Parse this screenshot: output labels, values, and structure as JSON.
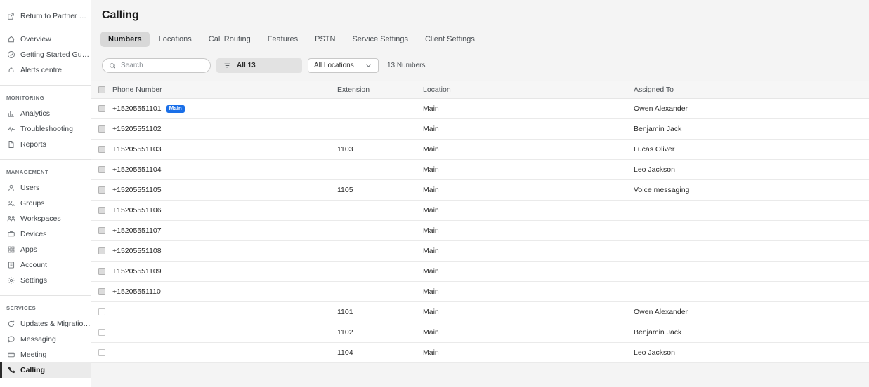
{
  "sidebar": {
    "top_link": {
      "label": "Return to Partner Hub",
      "icon": "external-link-icon"
    },
    "primary": [
      {
        "label": "Overview",
        "icon": "home-icon"
      },
      {
        "label": "Getting Started Guide",
        "icon": "check-circle-icon"
      },
      {
        "label": "Alerts centre",
        "icon": "bell-icon"
      }
    ],
    "sections": [
      {
        "title": "MONITORING",
        "items": [
          {
            "label": "Analytics",
            "icon": "bar-chart-icon"
          },
          {
            "label": "Troubleshooting",
            "icon": "pulse-icon"
          },
          {
            "label": "Reports",
            "icon": "document-icon"
          }
        ]
      },
      {
        "title": "MANAGEMENT",
        "items": [
          {
            "label": "Users",
            "icon": "user-icon"
          },
          {
            "label": "Groups",
            "icon": "user-group-icon"
          },
          {
            "label": "Workspaces",
            "icon": "workspaces-icon"
          },
          {
            "label": "Devices",
            "icon": "device-icon"
          },
          {
            "label": "Apps",
            "icon": "apps-grid-icon"
          },
          {
            "label": "Account",
            "icon": "account-icon"
          },
          {
            "label": "Settings",
            "icon": "gear-icon"
          }
        ]
      },
      {
        "title": "SERVICES",
        "items": [
          {
            "label": "Updates & Migrations",
            "icon": "refresh-icon"
          },
          {
            "label": "Messaging",
            "icon": "chat-bubble-icon"
          },
          {
            "label": "Meeting",
            "icon": "video-icon"
          },
          {
            "label": "Calling",
            "icon": "phone-handset-icon",
            "active": true
          }
        ]
      }
    ]
  },
  "header": {
    "title": "Calling"
  },
  "tabs": [
    {
      "label": "Numbers",
      "active": true
    },
    {
      "label": "Locations",
      "active": false
    },
    {
      "label": "Call Routing",
      "active": false
    },
    {
      "label": "Features",
      "active": false
    },
    {
      "label": "PSTN",
      "active": false
    },
    {
      "label": "Service Settings",
      "active": false
    },
    {
      "label": "Client Settings",
      "active": false
    }
  ],
  "toolbar": {
    "search": {
      "placeholder": "Search",
      "value": "",
      "icon": "search-icon"
    },
    "filter_button": {
      "label": "All 13",
      "icon": "filter-lines-icon"
    },
    "location_select": {
      "value": "All Locations",
      "icon": "chevron-down-icon"
    },
    "count_label": "13 Numbers"
  },
  "table": {
    "columns": [
      "Phone Number",
      "Extension",
      "Location",
      "Assigned To"
    ],
    "rows": [
      {
        "phone": "+15205551101",
        "badge": "Main",
        "ext": "",
        "loc": "Main",
        "assigned": "Owen Alexander",
        "checkbox": "gray"
      },
      {
        "phone": "+15205551102",
        "badge": "",
        "ext": "",
        "loc": "Main",
        "assigned": "Benjamin Jack",
        "checkbox": "gray"
      },
      {
        "phone": "+15205551103",
        "badge": "",
        "ext": "1103",
        "loc": "Main",
        "assigned": "Lucas Oliver",
        "checkbox": "gray"
      },
      {
        "phone": "+15205551104",
        "badge": "",
        "ext": "",
        "loc": "Main",
        "assigned": "Leo Jackson",
        "checkbox": "gray"
      },
      {
        "phone": "+15205551105",
        "badge": "",
        "ext": "1105",
        "loc": "Main",
        "assigned": "Voice messaging",
        "checkbox": "gray"
      },
      {
        "phone": "+15205551106",
        "badge": "",
        "ext": "",
        "loc": "Main",
        "assigned": "",
        "checkbox": "gray"
      },
      {
        "phone": "+15205551107",
        "badge": "",
        "ext": "",
        "loc": "Main",
        "assigned": "",
        "checkbox": "gray"
      },
      {
        "phone": "+15205551108",
        "badge": "",
        "ext": "",
        "loc": "Main",
        "assigned": "",
        "checkbox": "gray"
      },
      {
        "phone": "+15205551109",
        "badge": "",
        "ext": "",
        "loc": "Main",
        "assigned": "",
        "checkbox": "gray"
      },
      {
        "phone": "+15205551110",
        "badge": "",
        "ext": "",
        "loc": "Main",
        "assigned": "",
        "checkbox": "gray"
      },
      {
        "phone": "",
        "badge": "",
        "ext": "1101",
        "loc": "Main",
        "assigned": "Owen Alexander",
        "checkbox": "light"
      },
      {
        "phone": "",
        "badge": "",
        "ext": "1102",
        "loc": "Main",
        "assigned": "Benjamin Jack",
        "checkbox": "light"
      },
      {
        "phone": "",
        "badge": "",
        "ext": "1104",
        "loc": "Main",
        "assigned": "Leo Jackson",
        "checkbox": "light"
      }
    ]
  },
  "colors": {
    "badge_blue": "#1a6fe8",
    "active_nav_bg": "#ebebeb",
    "active_nav_bar": "#2b2b2b",
    "active_tab_bg": "#d8d8d8",
    "page_bg": "#f4f4f4",
    "table_header_bg": "#f6f6f6"
  }
}
